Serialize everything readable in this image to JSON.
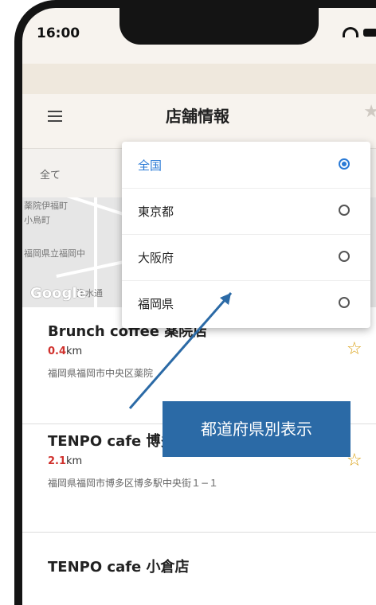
{
  "status": {
    "time": "16:00"
  },
  "header": {
    "title": "店舗情報"
  },
  "filter": {
    "all_label": "全て"
  },
  "map": {
    "labels": [
      "薬院伊福町",
      "小烏町",
      "福岡県立福岡中",
      "浄水通"
    ],
    "google": "Google"
  },
  "dropdown": {
    "options": [
      {
        "label": "全国",
        "selected": true
      },
      {
        "label": "東京都",
        "selected": false
      },
      {
        "label": "大阪府",
        "selected": false
      },
      {
        "label": "福岡県",
        "selected": false
      }
    ]
  },
  "shops": [
    {
      "name": "Brunch coffee 薬院店",
      "distance_num": "0.4",
      "distance_unit": "km",
      "address": "福岡県福岡市中央区薬院"
    },
    {
      "name": "TENPO cafe 博多店",
      "distance_num": "2.1",
      "distance_unit": "km",
      "address": "福岡県福岡市博多区博多駅中央街１−１"
    },
    {
      "name": "TENPO cafe 小倉店",
      "distance_num": "",
      "distance_unit": "",
      "address": ""
    }
  ],
  "callout": {
    "text": "都道府県別表示"
  }
}
